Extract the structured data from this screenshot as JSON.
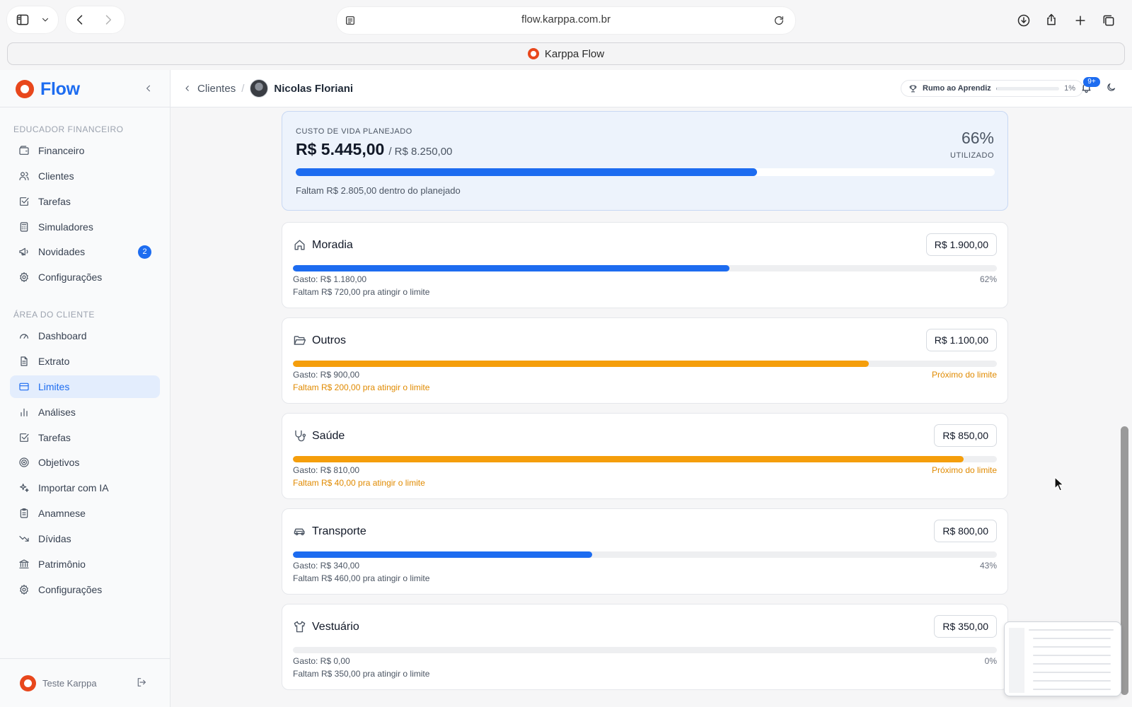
{
  "browser": {
    "url": "flow.karppa.com.br",
    "tab_title": "Karppa Flow"
  },
  "sidebar": {
    "brand": "Flow",
    "section_educator": "EDUCADOR FINANCEIRO",
    "educator_items": [
      {
        "label": "Financeiro",
        "icon": "wallet-icon"
      },
      {
        "label": "Clientes",
        "icon": "users-icon"
      },
      {
        "label": "Tarefas",
        "icon": "checkbox-icon"
      },
      {
        "label": "Simuladores",
        "icon": "calculator-icon"
      },
      {
        "label": "Novidades",
        "icon": "megaphone-icon",
        "badge": "2"
      },
      {
        "label": "Configurações",
        "icon": "gear-icon"
      }
    ],
    "section_client": "ÁREA DO CLIENTE",
    "client_items": [
      {
        "label": "Dashboard",
        "icon": "gauge-icon"
      },
      {
        "label": "Extrato",
        "icon": "document-icon"
      },
      {
        "label": "Limites",
        "icon": "card-icon",
        "active": true
      },
      {
        "label": "Análises",
        "icon": "bar-chart-icon"
      },
      {
        "label": "Tarefas",
        "icon": "checkbox-icon"
      },
      {
        "label": "Objetivos",
        "icon": "target-icon"
      },
      {
        "label": "Importar com IA",
        "icon": "sparkles-icon"
      },
      {
        "label": "Anamnese",
        "icon": "clipboard-icon"
      },
      {
        "label": "Dívidas",
        "icon": "trend-down-icon"
      },
      {
        "label": "Patrimônio",
        "icon": "bank-icon"
      },
      {
        "label": "Configurações",
        "icon": "gear-icon"
      }
    ],
    "user_name": "Teste Karppa"
  },
  "header": {
    "back_label": "Clientes",
    "separator": "/",
    "client_name": "Nicolas Floriani",
    "rank_label": "Rumo ao Aprendiz",
    "rank_progress_pct": 1,
    "rank_pct_text": "1%",
    "notification_badge": "9+"
  },
  "summary": {
    "label": "CUSTO DE VIDA PLANEJADO",
    "spent": "R$ 5.445,00",
    "total": "/ R$ 8.250,00",
    "pct_text": "66%",
    "pct_value": 66,
    "used_label": "UTILIZADO",
    "remaining": "Faltam R$ 2.805,00 dentro do planejado"
  },
  "categories": [
    {
      "name": "Moradia",
      "icon": "home-icon",
      "limit": "R$ 1.900,00",
      "spent": "Gasto: R$ 1.180,00",
      "status": "62%",
      "remaining": "Faltam R$ 720,00 pra atingir o limite",
      "progress": 62,
      "level": "normal"
    },
    {
      "name": "Outros",
      "icon": "folder-open-icon",
      "limit": "R$ 1.100,00",
      "spent": "Gasto: R$ 900,00",
      "status": "Próximo do limite",
      "remaining": "Faltam R$ 200,00 pra atingir o limite",
      "progress": 81.8,
      "level": "warn"
    },
    {
      "name": "Saúde",
      "icon": "stethoscope-icon",
      "limit": "R$ 850,00",
      "spent": "Gasto: R$ 810,00",
      "status": "Próximo do limite",
      "remaining": "Faltam R$ 40,00 pra atingir o limite",
      "progress": 95.3,
      "level": "warn"
    },
    {
      "name": "Transporte",
      "icon": "car-icon",
      "limit": "R$ 800,00",
      "spent": "Gasto: R$ 340,00",
      "status": "43%",
      "remaining": "Faltam R$ 460,00 pra atingir o limite",
      "progress": 42.5,
      "level": "normal"
    },
    {
      "name": "Vestuário",
      "icon": "shirt-icon",
      "limit": "R$ 350,00",
      "spent": "Gasto: R$ 0,00",
      "status": "0%",
      "remaining": "Faltam R$ 350,00 pra atingir o limite",
      "progress": 0,
      "level": "normal"
    }
  ],
  "colors": {
    "accent": "#1d6cf0",
    "warning": "#f59e0b",
    "brand_logo": "#e8471c"
  }
}
